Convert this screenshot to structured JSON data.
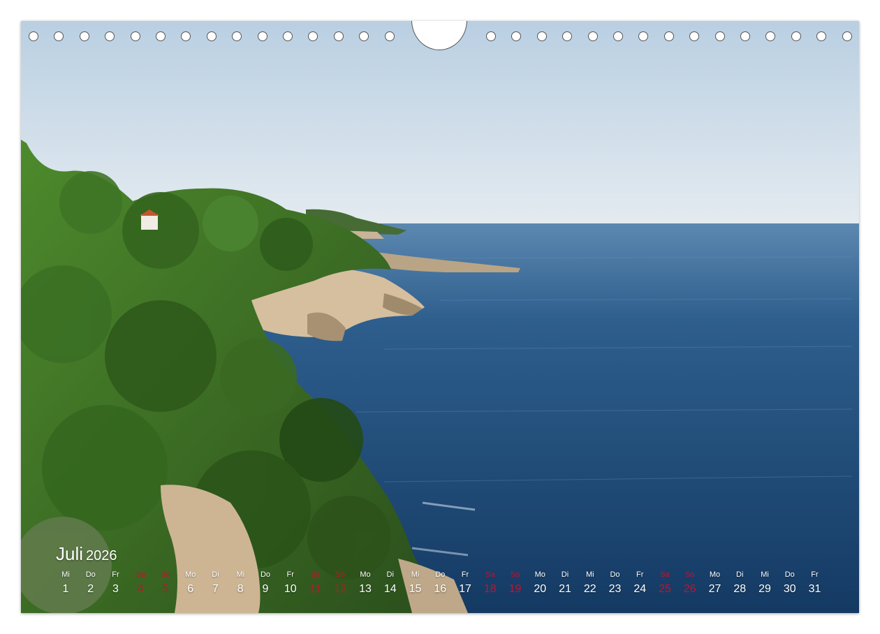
{
  "calendar": {
    "month": "Juli",
    "year": "2026",
    "days": [
      {
        "weekday": "Mi",
        "date": "1",
        "weekend": false
      },
      {
        "weekday": "Do",
        "date": "2",
        "weekend": false
      },
      {
        "weekday": "Fr",
        "date": "3",
        "weekend": false
      },
      {
        "weekday": "Sa",
        "date": "4",
        "weekend": true
      },
      {
        "weekday": "So",
        "date": "5",
        "weekend": true
      },
      {
        "weekday": "Mo",
        "date": "6",
        "weekend": false
      },
      {
        "weekday": "Di",
        "date": "7",
        "weekend": false
      },
      {
        "weekday": "Mi",
        "date": "8",
        "weekend": false
      },
      {
        "weekday": "Do",
        "date": "9",
        "weekend": false
      },
      {
        "weekday": "Fr",
        "date": "10",
        "weekend": false
      },
      {
        "weekday": "Sa",
        "date": "11",
        "weekend": true
      },
      {
        "weekday": "So",
        "date": "12",
        "weekend": true
      },
      {
        "weekday": "Mo",
        "date": "13",
        "weekend": false
      },
      {
        "weekday": "Di",
        "date": "14",
        "weekend": false
      },
      {
        "weekday": "Mi",
        "date": "15",
        "weekend": false
      },
      {
        "weekday": "Do",
        "date": "16",
        "weekend": false
      },
      {
        "weekday": "Fr",
        "date": "17",
        "weekend": false
      },
      {
        "weekday": "Sa",
        "date": "18",
        "weekend": true
      },
      {
        "weekday": "So",
        "date": "19",
        "weekend": true
      },
      {
        "weekday": "Mo",
        "date": "20",
        "weekend": false
      },
      {
        "weekday": "Di",
        "date": "21",
        "weekend": false
      },
      {
        "weekday": "Mi",
        "date": "22",
        "weekend": false
      },
      {
        "weekday": "Do",
        "date": "23",
        "weekend": false
      },
      {
        "weekday": "Fr",
        "date": "24",
        "weekend": false
      },
      {
        "weekday": "Sa",
        "date": "25",
        "weekend": true
      },
      {
        "weekday": "So",
        "date": "26",
        "weekend": true
      },
      {
        "weekday": "Mo",
        "date": "27",
        "weekend": false
      },
      {
        "weekday": "Di",
        "date": "28",
        "weekend": false
      },
      {
        "weekday": "Mi",
        "date": "29",
        "weekend": false
      },
      {
        "weekday": "Do",
        "date": "30",
        "weekend": false
      },
      {
        "weekday": "Fr",
        "date": "31",
        "weekend": false
      }
    ]
  },
  "colors": {
    "sky": "#d4e2ee",
    "sea": "#1f4c78",
    "foliage": "#3a6b24",
    "rock": "#d9c3a4",
    "weekend": "#c8102e",
    "text": "#ffffff"
  },
  "binding": {
    "hole_count": 33,
    "hanger": "hanging-cutout"
  }
}
